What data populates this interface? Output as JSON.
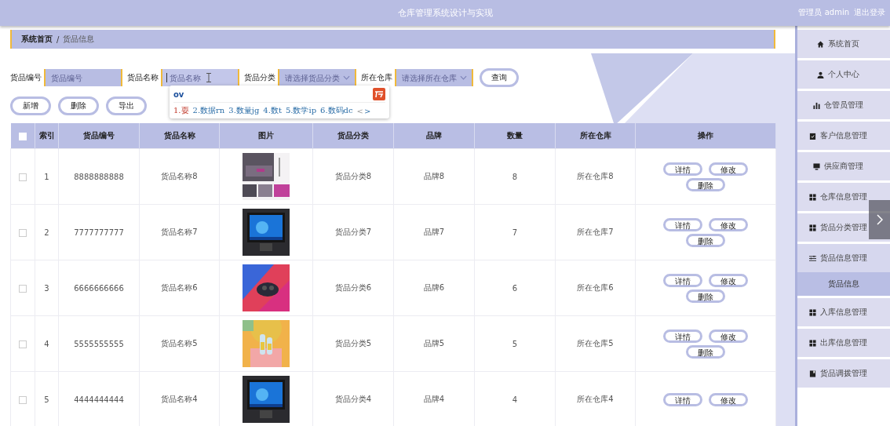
{
  "header": {
    "title": "仓库管理系统设计与实现",
    "user": "管理员 admin",
    "logout": "退出登录"
  },
  "breadcrumb": [
    {
      "label": "系统首页",
      "current": false
    },
    {
      "label": "/",
      "kind": "separator"
    },
    {
      "label": "货品信息",
      "current": true
    }
  ],
  "search": {
    "fields": [
      {
        "label": "货品编号",
        "placeholder": "货品编号",
        "kind": "input",
        "focused": false
      },
      {
        "label": "货品名称",
        "placeholder": "货品名称",
        "kind": "input",
        "focused": true
      },
      {
        "label": "货品分类",
        "placeholder": "请选择货品分类",
        "kind": "select",
        "focused": false
      },
      {
        "label": "所在仓库",
        "placeholder": "请选择所在仓库",
        "kind": "select",
        "focused": false
      }
    ],
    "button": "查询"
  },
  "ime_popup": {
    "composition": "ov",
    "candidates": [
      {
        "text": "1.耍",
        "selected": true
      },
      {
        "text": "2.数据rn",
        "selected": false
      },
      {
        "text": "3.数量jg",
        "selected": false
      },
      {
        "text": "4.数t",
        "selected": false
      },
      {
        "text": "5.数学ip",
        "selected": false
      },
      {
        "text": "6.数码dc",
        "selected": false
      }
    ],
    "prev": "<",
    "next": ">"
  },
  "actions": [
    "新增",
    "删除",
    "导出"
  ],
  "table": {
    "select_all": {
      "checked": false
    },
    "columns": [
      "索引",
      "货品编号",
      "货品名称",
      "图片",
      "货品分类",
      "品牌",
      "数量",
      "所在仓库",
      "操作"
    ],
    "rows": [
      {
        "checked": false,
        "index": "1",
        "code": "8888888888",
        "name": "货品名称8",
        "picture": {
          "kind": "picture"
        },
        "category": "货品分类8",
        "brand": "品牌8",
        "quantity": "8",
        "warehouse": "所在仓库8",
        "buttons": [
          "详情",
          "修改",
          "删除"
        ]
      },
      {
        "checked": false,
        "index": "2",
        "code": "7777777777",
        "name": "货品名称7",
        "picture": {
          "kind": "picture"
        },
        "category": "货品分类7",
        "brand": "品牌7",
        "quantity": "7",
        "warehouse": "所在仓库7",
        "buttons": [
          "详情",
          "修改",
          "删除"
        ]
      },
      {
        "checked": false,
        "index": "3",
        "code": "6666666666",
        "name": "货品名称6",
        "picture": {
          "kind": "picture"
        },
        "category": "货品分类6",
        "brand": "品牌6",
        "quantity": "6",
        "warehouse": "所在仓库6",
        "buttons": [
          "详情",
          "修改",
          "删除"
        ]
      },
      {
        "checked": false,
        "index": "4",
        "code": "5555555555",
        "name": "货品名称5",
        "picture": {
          "kind": "picture"
        },
        "category": "货品分类5",
        "brand": "品牌5",
        "quantity": "5",
        "warehouse": "所在仓库5",
        "buttons": [
          "详情",
          "修改",
          "删除"
        ]
      },
      {
        "checked": false,
        "index": "5",
        "code": "4444444444",
        "name": "货品名称4",
        "picture": {
          "kind": "picture"
        },
        "category": "货品分类4",
        "brand": "品牌4",
        "quantity": "4",
        "warehouse": "所在仓库4",
        "buttons": [
          "详情",
          "修改"
        ]
      }
    ]
  },
  "sidebar": {
    "items": [
      {
        "label": "系统首页",
        "selected": false
      },
      {
        "label": "个人中心",
        "selected": false
      },
      {
        "label": "仓管员管理",
        "selected": false
      },
      {
        "label": "客户信息管理",
        "selected": false
      },
      {
        "label": "供应商管理",
        "selected": false
      },
      {
        "label": "仓库信息管理",
        "selected": false
      },
      {
        "label": "货品分类管理",
        "selected": false
      },
      {
        "label": "货品信息管理",
        "selected": false,
        "expanded": true,
        "children": [
          {
            "label": "货品信息",
            "selected": true
          }
        ]
      },
      {
        "label": "入库信息管理",
        "selected": false
      },
      {
        "label": "出库信息管理",
        "selected": false
      },
      {
        "label": "货品调拨管理",
        "selected": false
      }
    ]
  }
}
